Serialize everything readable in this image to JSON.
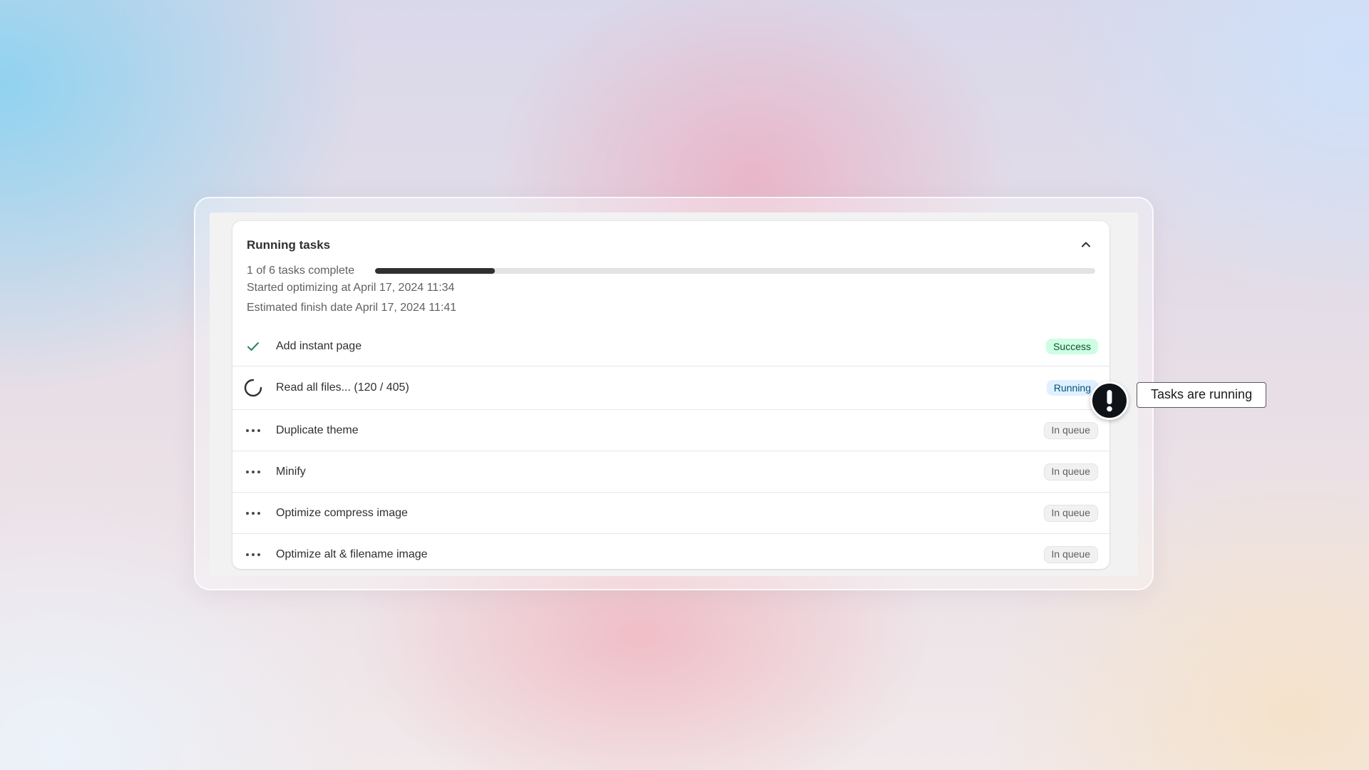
{
  "panel": {
    "title": "Running tasks",
    "progress": {
      "label": "1 of 6 tasks complete",
      "completed": 1,
      "total": 6
    },
    "started": "Started optimizing at April 17, 2024 11:34",
    "estimated_finish": "Estimated finish date April 17, 2024 11:41"
  },
  "tasks": [
    {
      "label": "Add instant page",
      "status": "Success",
      "status_kind": "success",
      "icon": "checkmark-icon"
    },
    {
      "label": "Read all files... (120 / 405)",
      "status": "Running",
      "status_kind": "running",
      "icon": "spinner-icon"
    },
    {
      "label": "Duplicate theme",
      "status": "In queue",
      "status_kind": "queue",
      "icon": "ellipsis-icon"
    },
    {
      "label": "Minify",
      "status": "In queue",
      "status_kind": "queue",
      "icon": "ellipsis-icon"
    },
    {
      "label": "Optimize compress image",
      "status": "In queue",
      "status_kind": "queue",
      "icon": "ellipsis-icon"
    },
    {
      "label": "Optimize alt & filename image",
      "status": "In queue",
      "status_kind": "queue",
      "icon": "ellipsis-icon"
    }
  ],
  "callout": {
    "icon": "exclamation-icon",
    "text": "Tasks are running"
  },
  "colors": {
    "success_bg": "#cdfee1",
    "running_bg": "#e0f0ff",
    "progress_fill": "#303030",
    "check": "#29845a"
  }
}
